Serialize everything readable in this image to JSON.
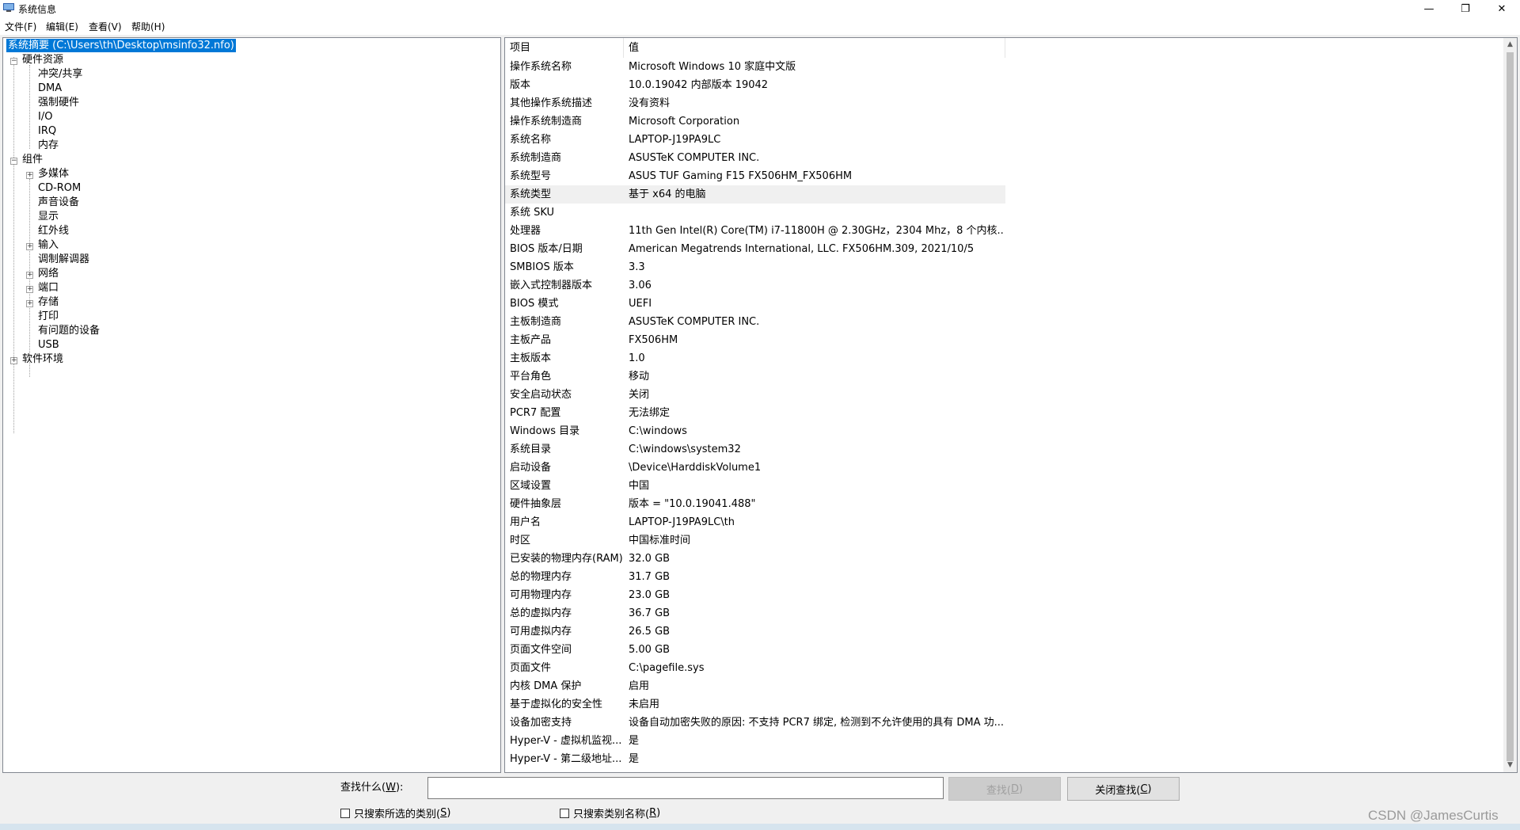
{
  "window": {
    "title": "系统信息",
    "minimize_glyph": "—",
    "maximize_glyph": "❐",
    "close_glyph": "✕"
  },
  "menu": [
    "文件(F)",
    "编辑(E)",
    "查看(V)",
    "帮助(H)"
  ],
  "tree": {
    "root": "系统摘要 (C:\\Users\\th\\Desktop\\msinfo32.nfo)",
    "hardware": {
      "label": "硬件资源",
      "children": [
        "冲突/共享",
        "DMA",
        "强制硬件",
        "I/O",
        "IRQ",
        "内存"
      ]
    },
    "components": {
      "label": "组件",
      "children": [
        "多媒体",
        "CD-ROM",
        "声音设备",
        "显示",
        "红外线",
        "输入",
        "调制解调器",
        "网络",
        "端口",
        "存储",
        "打印",
        "有问题的设备",
        "USB"
      ]
    },
    "software": {
      "label": "软件环境"
    }
  },
  "list": {
    "headers": [
      "项目",
      "值"
    ],
    "rows": [
      [
        "操作系统名称",
        "Microsoft Windows 10 家庭中文版"
      ],
      [
        "版本",
        "10.0.19042 内部版本 19042"
      ],
      [
        "其他操作系统描述",
        "没有资料"
      ],
      [
        "操作系统制造商",
        "Microsoft Corporation"
      ],
      [
        "系统名称",
        "LAPTOP-J19PA9LC"
      ],
      [
        "系统制造商",
        "ASUSTeK COMPUTER INC."
      ],
      [
        "系统型号",
        "ASUS TUF Gaming F15 FX506HM_FX506HM"
      ],
      [
        "系统类型",
        "基于 x64 的电脑"
      ],
      [
        "系统 SKU",
        ""
      ],
      [
        "处理器",
        "11th Gen Intel(R) Core(TM) i7-11800H @ 2.30GHz，2304 Mhz，8 个内核..."
      ],
      [
        "BIOS 版本/日期",
        "American Megatrends International, LLC. FX506HM.309, 2021/10/5"
      ],
      [
        "SMBIOS 版本",
        "3.3"
      ],
      [
        "嵌入式控制器版本",
        "3.06"
      ],
      [
        "BIOS 模式",
        "UEFI"
      ],
      [
        "主板制造商",
        "ASUSTeK COMPUTER INC."
      ],
      [
        "主板产品",
        "FX506HM"
      ],
      [
        "主板版本",
        "1.0"
      ],
      [
        "平台角色",
        "移动"
      ],
      [
        "安全启动状态",
        "关闭"
      ],
      [
        "PCR7 配置",
        "无法绑定"
      ],
      [
        "Windows 目录",
        "C:\\windows"
      ],
      [
        "系统目录",
        "C:\\windows\\system32"
      ],
      [
        "启动设备",
        "\\Device\\HarddiskVolume1"
      ],
      [
        "区域设置",
        "中国"
      ],
      [
        "硬件抽象层",
        "版本 = \"10.0.19041.488\""
      ],
      [
        "用户名",
        "LAPTOP-J19PA9LC\\th"
      ],
      [
        "时区",
        "中国标准时间"
      ],
      [
        "已安装的物理内存(RAM)",
        "32.0 GB"
      ],
      [
        "总的物理内存",
        "31.7 GB"
      ],
      [
        "可用物理内存",
        "23.0 GB"
      ],
      [
        "总的虚拟内存",
        "36.7 GB"
      ],
      [
        "可用虚拟内存",
        "26.5 GB"
      ],
      [
        "页面文件空间",
        "5.00 GB"
      ],
      [
        "页面文件",
        "C:\\pagefile.sys"
      ],
      [
        "内核 DMA 保护",
        "启用"
      ],
      [
        "基于虚拟化的安全性",
        "未启用"
      ],
      [
        "设备加密支持",
        "设备自动加密失败的原因: 不支持 PCR7 绑定, 检测到不允许使用的具有 DMA 功..."
      ],
      [
        "Hyper-V - 虚拟机监视...",
        "是"
      ],
      [
        "Hyper-V - 第二级地址...",
        "是"
      ]
    ]
  },
  "find": {
    "label_prefix": "查找什么(",
    "label_key": "W",
    "label_suffix": "):",
    "value": "",
    "find_button_prefix": "查找(",
    "find_button_key": "D",
    "find_button_suffix": ")",
    "close_button_prefix": "关闭查找(",
    "close_button_key": "C",
    "close_button_suffix": ")",
    "check1_prefix": "只搜索所选的类别(",
    "check1_key": "S",
    "check1_suffix": ")",
    "check2_prefix": "只搜索类别名称(",
    "check2_key": "R",
    "check2_suffix": ")"
  },
  "watermark": "CSDN @JamesCurtis"
}
